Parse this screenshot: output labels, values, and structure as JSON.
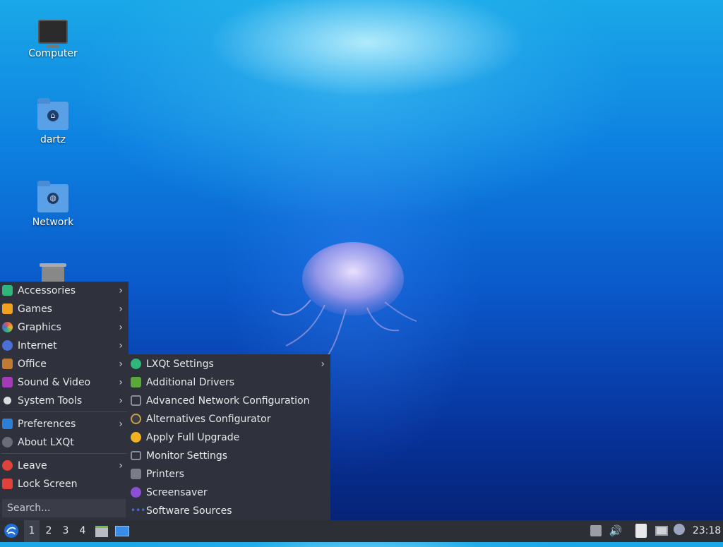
{
  "desktop": {
    "icons": [
      {
        "label": "Computer",
        "icon": "computer-icon"
      },
      {
        "label": "dartz",
        "icon": "home-folder-icon"
      },
      {
        "label": "Network",
        "icon": "network-folder-icon"
      },
      {
        "label": "",
        "icon": "trash-icon"
      }
    ]
  },
  "main_menu": {
    "items": [
      {
        "label": "Accessories",
        "icon": "accessories-icon",
        "color": "#2fb67a",
        "submenu": true
      },
      {
        "label": "Games",
        "icon": "games-icon",
        "color": "#f0a21f",
        "submenu": true
      },
      {
        "label": "Graphics",
        "icon": "graphics-icon",
        "color": "#e2534d",
        "submenu": true
      },
      {
        "label": "Internet",
        "icon": "internet-icon",
        "color": "#4a6fd6",
        "submenu": true
      },
      {
        "label": "Office",
        "icon": "office-icon",
        "color": "#c07a33",
        "submenu": true
      },
      {
        "label": "Sound & Video",
        "icon": "sound-video-icon",
        "color": "#a53ab8",
        "submenu": true
      },
      {
        "label": "System Tools",
        "icon": "system-tools-icon",
        "color": "#6a6d76",
        "submenu": true
      },
      {
        "label": "Preferences",
        "icon": "preferences-icon",
        "color": "#2b7fd8",
        "submenu": true
      },
      {
        "label": "About LXQt",
        "icon": "info-icon",
        "color": "#6a6d76",
        "submenu": false
      },
      {
        "label": "Leave",
        "icon": "power-icon",
        "color": "#e0413a",
        "submenu": true
      },
      {
        "label": "Lock Screen",
        "icon": "lock-icon",
        "color": "#e0413a",
        "submenu": false
      }
    ],
    "search_placeholder": "Search..."
  },
  "preferences_submenu": {
    "items": [
      {
        "label": "LXQt Settings",
        "icon": "lxqt-settings-icon",
        "color": "#2fb67a",
        "submenu": true
      },
      {
        "label": "Additional Drivers",
        "icon": "drivers-icon",
        "color": "#59a83a",
        "submenu": false
      },
      {
        "label": "Advanced Network Configuration",
        "icon": "network-config-icon",
        "color": "#8a8d95",
        "submenu": false
      },
      {
        "label": "Alternatives Configurator",
        "icon": "alternatives-icon",
        "color": "#c9a33a",
        "submenu": false
      },
      {
        "label": "Apply Full Upgrade",
        "icon": "upgrade-icon",
        "color": "#f0b31f",
        "submenu": false
      },
      {
        "label": "Monitor Settings",
        "icon": "monitor-icon",
        "color": "#6a6d76",
        "submenu": false
      },
      {
        "label": "Printers",
        "icon": "printer-icon",
        "color": "#7a7d86",
        "submenu": false
      },
      {
        "label": "Screensaver",
        "icon": "screensaver-icon",
        "color": "#8a4fd6",
        "submenu": false
      },
      {
        "label": "Software Sources",
        "icon": "software-sources-icon",
        "color": "#4a6fd6",
        "submenu": false
      }
    ]
  },
  "taskbar": {
    "workspaces": [
      "1",
      "2",
      "3",
      "4"
    ],
    "active_workspace": "1",
    "clock": "23:18"
  },
  "arrow_glyph": "›"
}
